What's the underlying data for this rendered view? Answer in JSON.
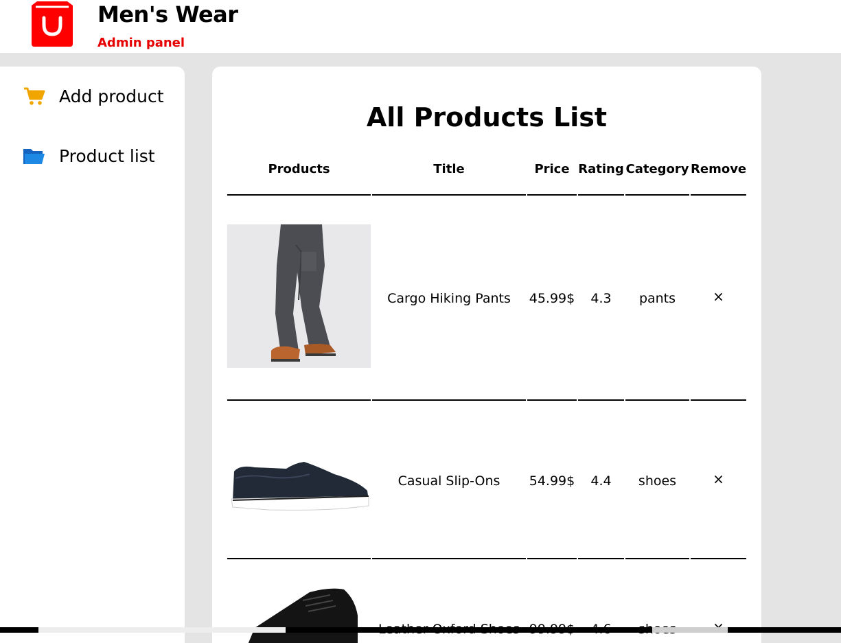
{
  "brand": {
    "title": "Men's Wear",
    "subtitle": "Admin panel",
    "logo_icon": "shopping-bag-icon",
    "accent": "#ff0000"
  },
  "sidebar": {
    "items": [
      {
        "label": "Add product",
        "icon": "cart-icon",
        "icon_color": "#f0a500"
      },
      {
        "label": "Product list",
        "icon": "folder-icon",
        "icon_color": "#1a73e8"
      }
    ]
  },
  "main": {
    "title": "All Products List",
    "columns": [
      "Products",
      "Title",
      "Price",
      "Rating",
      "Category",
      "Remove"
    ],
    "rows": [
      {
        "title": "Cargo Hiking Pants",
        "price": "45.99$",
        "rating": "4.3",
        "category": "pants",
        "remove": "×"
      },
      {
        "title": "Casual Slip-Ons",
        "price": "54.99$",
        "rating": "4.4",
        "category": "shoes",
        "remove": "×"
      },
      {
        "title": "Leather Oxford Shoes",
        "price": "99.99$",
        "rating": "4.6",
        "category": "shoes",
        "remove": "×"
      }
    ]
  }
}
